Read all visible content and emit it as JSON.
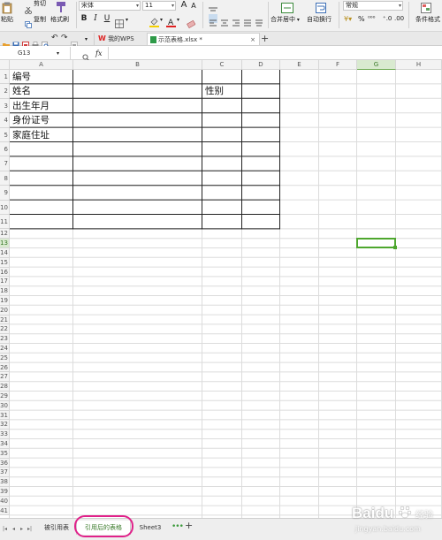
{
  "ribbon": {
    "cut": "剪切",
    "copy": "复制",
    "format_painter": "格式刷",
    "paste": "粘贴",
    "font_name": "宋体",
    "font_size": "11",
    "bold": "B",
    "italic": "I",
    "underline": "U",
    "merge_center": "合并居中",
    "wrap_text": "自动换行",
    "number_format": "常规",
    "cond_format": "条件格式"
  },
  "doc_tabs": [
    {
      "label": "我的WPS"
    },
    {
      "label": "示范表格.xlsx *"
    }
  ],
  "formula_bar": {
    "name_box": "G13",
    "fx": "fx",
    "value": ""
  },
  "columns": [
    "A",
    "B",
    "C",
    "D",
    "E",
    "F",
    "G",
    "H"
  ],
  "rows": [
    "1",
    "2",
    "3",
    "4",
    "5",
    "6",
    "7",
    "8",
    "9",
    "10",
    "11",
    "12",
    "13",
    "14",
    "15",
    "16",
    "17",
    "18",
    "19",
    "20",
    "21",
    "22",
    "23",
    "24",
    "25",
    "26",
    "27",
    "28",
    "29",
    "30",
    "31",
    "32",
    "33",
    "34",
    "35",
    "36",
    "37",
    "38",
    "39",
    "40",
    "41"
  ],
  "cells": {
    "A1": "编号",
    "A2": "姓名",
    "A3": "出生年月",
    "A4": "身份证号",
    "A5": "家庭住址",
    "C2": "性别"
  },
  "selected": {
    "col": "G",
    "row": "13"
  },
  "sheet_tabs": [
    {
      "label": "被引用表",
      "active": false
    },
    {
      "label": "引用后的表格",
      "active": true
    },
    {
      "label": "Sheet3",
      "active": false
    }
  ],
  "colors": {
    "selection": "#4ea72e",
    "highlight": "#e0218a",
    "active_tab_text": "#3a7a2a"
  },
  "watermark": {
    "brand": "Baidu",
    "sub": "经验",
    "url": "jingyan.baidu.com"
  }
}
